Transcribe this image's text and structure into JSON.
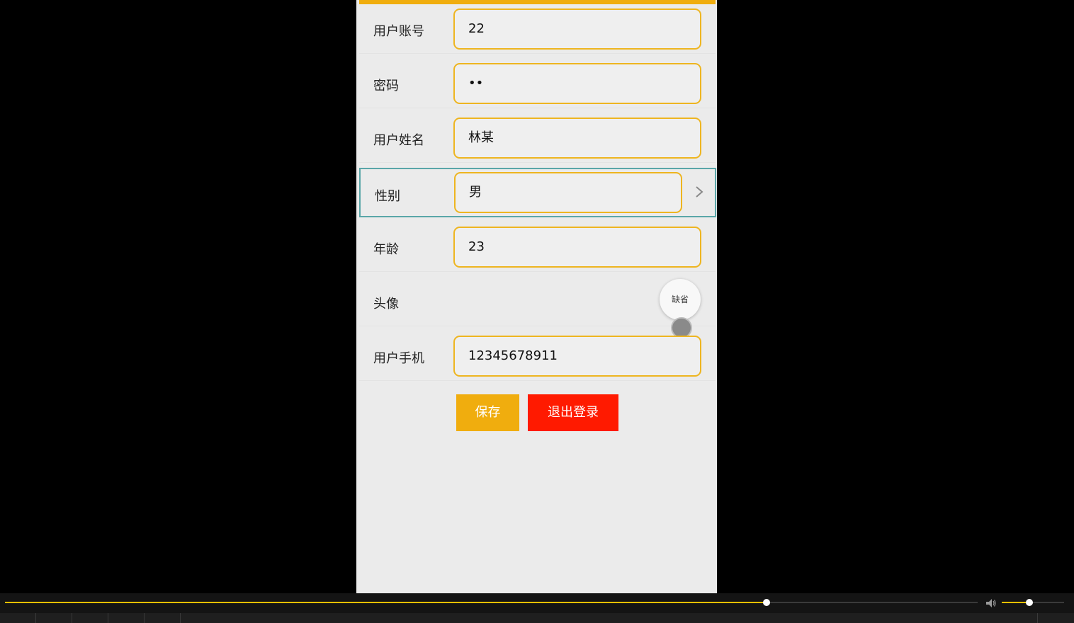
{
  "form": {
    "account": {
      "label": "用户账号",
      "value": "22"
    },
    "password": {
      "label": "密码",
      "value": "••"
    },
    "name": {
      "label": "用户姓名",
      "value": "林某"
    },
    "gender": {
      "label": "性别",
      "value": "男"
    },
    "age": {
      "label": "年龄",
      "value": "23"
    },
    "avatar": {
      "label": "头像",
      "placeholder_text": "缺省"
    },
    "phone": {
      "label": "用户手机",
      "value": "12345678911"
    }
  },
  "actions": {
    "save_label": "保存",
    "logout_label": "退出登录"
  },
  "player": {
    "progress_fraction": 0.783,
    "volume_fraction": 0.44
  },
  "colors": {
    "accent": "#f0ad0e",
    "danger": "#ff1a00",
    "field_border": "#eeb520"
  }
}
